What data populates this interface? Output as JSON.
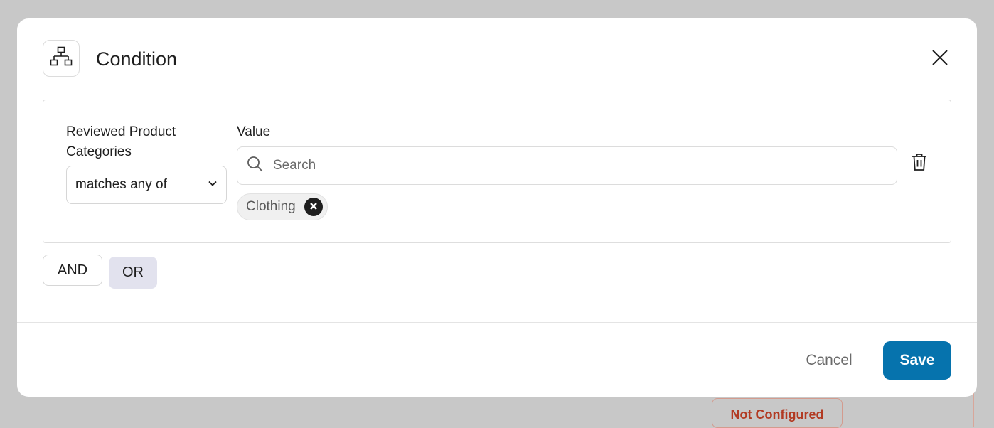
{
  "background": {
    "badge_label": "Not Configured"
  },
  "modal": {
    "title": "Condition",
    "header_icon": "sitemap-icon",
    "close_icon": "close-icon"
  },
  "condition": {
    "field_label": "Reviewed Product Categories",
    "operator": {
      "selected": "matches any of",
      "icon": "chevron-down-icon"
    },
    "value_label": "Value",
    "search": {
      "placeholder": "Search",
      "value": "",
      "icon": "search-icon"
    },
    "chips": [
      {
        "label": "Clothing",
        "remove_icon": "close-circle-icon"
      }
    ],
    "delete_icon": "trash-icon"
  },
  "logic_buttons": {
    "and_label": "AND",
    "or_label": "OR",
    "active": "OR"
  },
  "footer": {
    "cancel_label": "Cancel",
    "save_label": "Save"
  },
  "colors": {
    "primary": "#0673ad",
    "active_logic_bg": "#e2e2ee",
    "overlay": "#c8c8c8",
    "error_text": "#b23a22"
  }
}
